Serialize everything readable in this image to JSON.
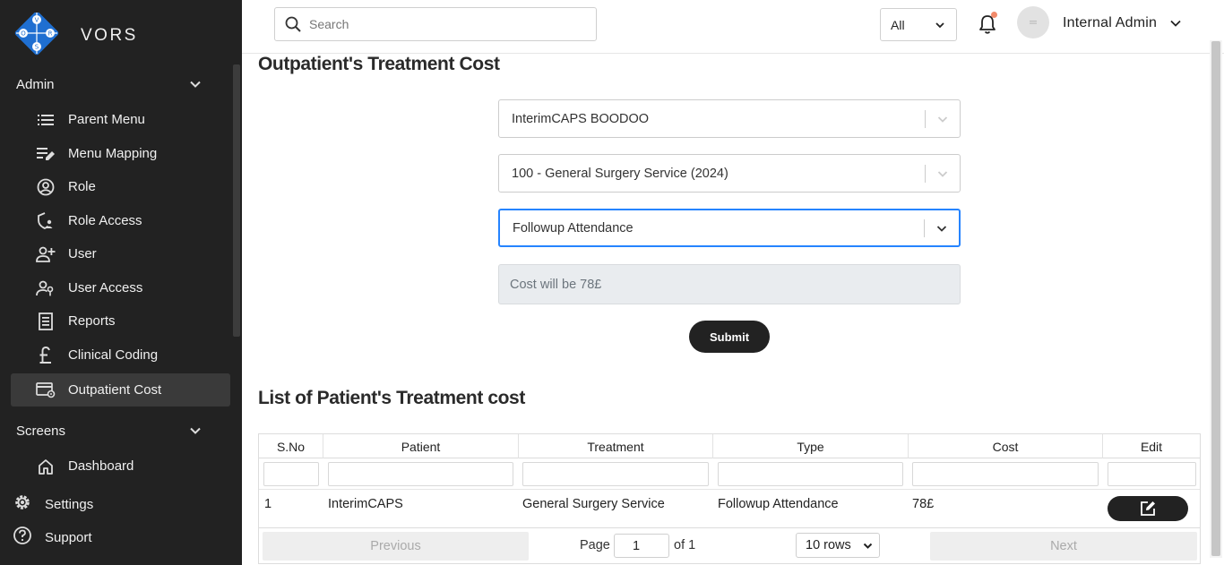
{
  "brand": {
    "name": "VORS",
    "logo_letters": [
      "V",
      "O",
      "R",
      "S"
    ]
  },
  "sidebar": {
    "sections": [
      {
        "label": "Admin"
      },
      {
        "label": "Screens"
      }
    ],
    "admin_items": [
      {
        "label": "Parent Menu",
        "icon": "list-icon"
      },
      {
        "label": "Menu Mapping",
        "icon": "edit-list-icon"
      },
      {
        "label": "Role",
        "icon": "account-circle-icon"
      },
      {
        "label": "Role Access",
        "icon": "shield-person-icon"
      },
      {
        "label": "User",
        "icon": "person-add-icon"
      },
      {
        "label": "User Access",
        "icon": "person-key-icon"
      },
      {
        "label": "Reports",
        "icon": "report-icon"
      },
      {
        "label": "Clinical Coding",
        "icon": "pound-icon"
      },
      {
        "label": "Outpatient Cost",
        "icon": "card-settings-icon",
        "active": true
      }
    ],
    "screens_items": [
      {
        "label": "Dashboard",
        "icon": "home-icon"
      }
    ],
    "bottom_items": [
      {
        "label": "Settings",
        "icon": "gear-icon"
      },
      {
        "label": "Support",
        "icon": "help-icon"
      }
    ]
  },
  "topbar": {
    "search_placeholder": "Search",
    "filter_value": "All",
    "user_name": "Internal Admin"
  },
  "form": {
    "title": "Outpatient's Treatment Cost",
    "patient": "InterimCAPS BOODOO",
    "treatment": "100 - General Surgery Service (2024)",
    "type": "Followup Attendance",
    "cost_text": "Cost will be 78£",
    "submit_label": "Submit"
  },
  "table": {
    "title": "List of Patient's Treatment cost",
    "columns": [
      "S.No",
      "Patient",
      "Treatment",
      "Type",
      "Cost",
      "Edit"
    ],
    "rows": [
      {
        "sno": "1",
        "patient": "InterimCAPS",
        "treatment": "General Surgery Service",
        "type": "Followup Attendance",
        "cost": "78£"
      }
    ],
    "pagination": {
      "previous": "Previous",
      "page_label": "Page",
      "page_value": "1",
      "of_label": "of 1",
      "rows_option": "10 rows",
      "next": "Next"
    }
  },
  "colors": {
    "sidebar_bg": "#222222",
    "active_item_bg": "#3a3a3a",
    "logo_blue": "#1f6fd1",
    "focus_blue": "#2684ff",
    "notification_dot": "#f28a6a"
  }
}
